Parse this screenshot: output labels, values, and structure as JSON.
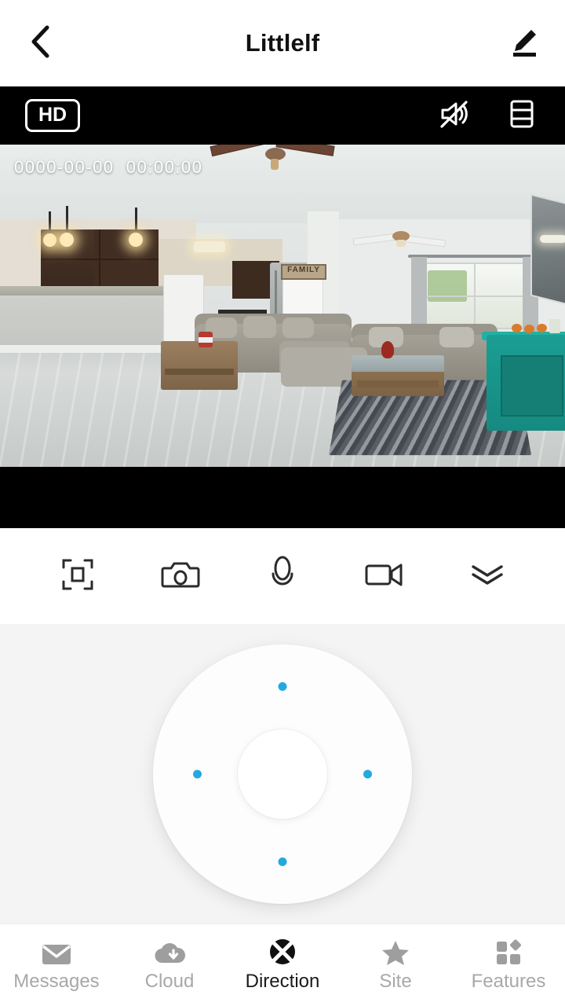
{
  "header": {
    "title": "Littlelf",
    "back_icon": "chevron-left-icon",
    "edit_icon": "pencil-edit-icon"
  },
  "video": {
    "quality_badge": "HD",
    "timestamp": "0000-00-00  00:00:00",
    "mute_icon": "speaker-muted-icon",
    "layout_icon": "split-layout-icon",
    "scene_description": "Live camera view of an open-plan living room and kitchen"
  },
  "controls": [
    {
      "name": "fullscreen-button",
      "icon": "fullscreen-frame-icon"
    },
    {
      "name": "snapshot-button",
      "icon": "camera-icon"
    },
    {
      "name": "talk-button",
      "icon": "microphone-icon"
    },
    {
      "name": "record-button",
      "icon": "video-camera-icon"
    },
    {
      "name": "collapse-button",
      "icon": "double-chevron-down-icon"
    }
  ],
  "dpad": {
    "name": "direction-pad",
    "dot_color": "#23a9e0",
    "directions": [
      "up",
      "right",
      "down",
      "left"
    ]
  },
  "tabs": [
    {
      "label": "Messages",
      "icon": "envelope-icon",
      "active": false
    },
    {
      "label": "Cloud",
      "icon": "cloud-download-icon",
      "active": false
    },
    {
      "label": "Direction",
      "icon": "direction-cross-icon",
      "active": true
    },
    {
      "label": "Site",
      "icon": "star-icon",
      "active": false
    },
    {
      "label": "Features",
      "icon": "grid-features-icon",
      "active": false
    }
  ],
  "colors": {
    "accent": "#23a9e0",
    "active_text": "#1a1a1a",
    "inactive_text": "#a8a8a8",
    "panel_bg": "#f4f4f4",
    "video_bg": "#000000"
  }
}
